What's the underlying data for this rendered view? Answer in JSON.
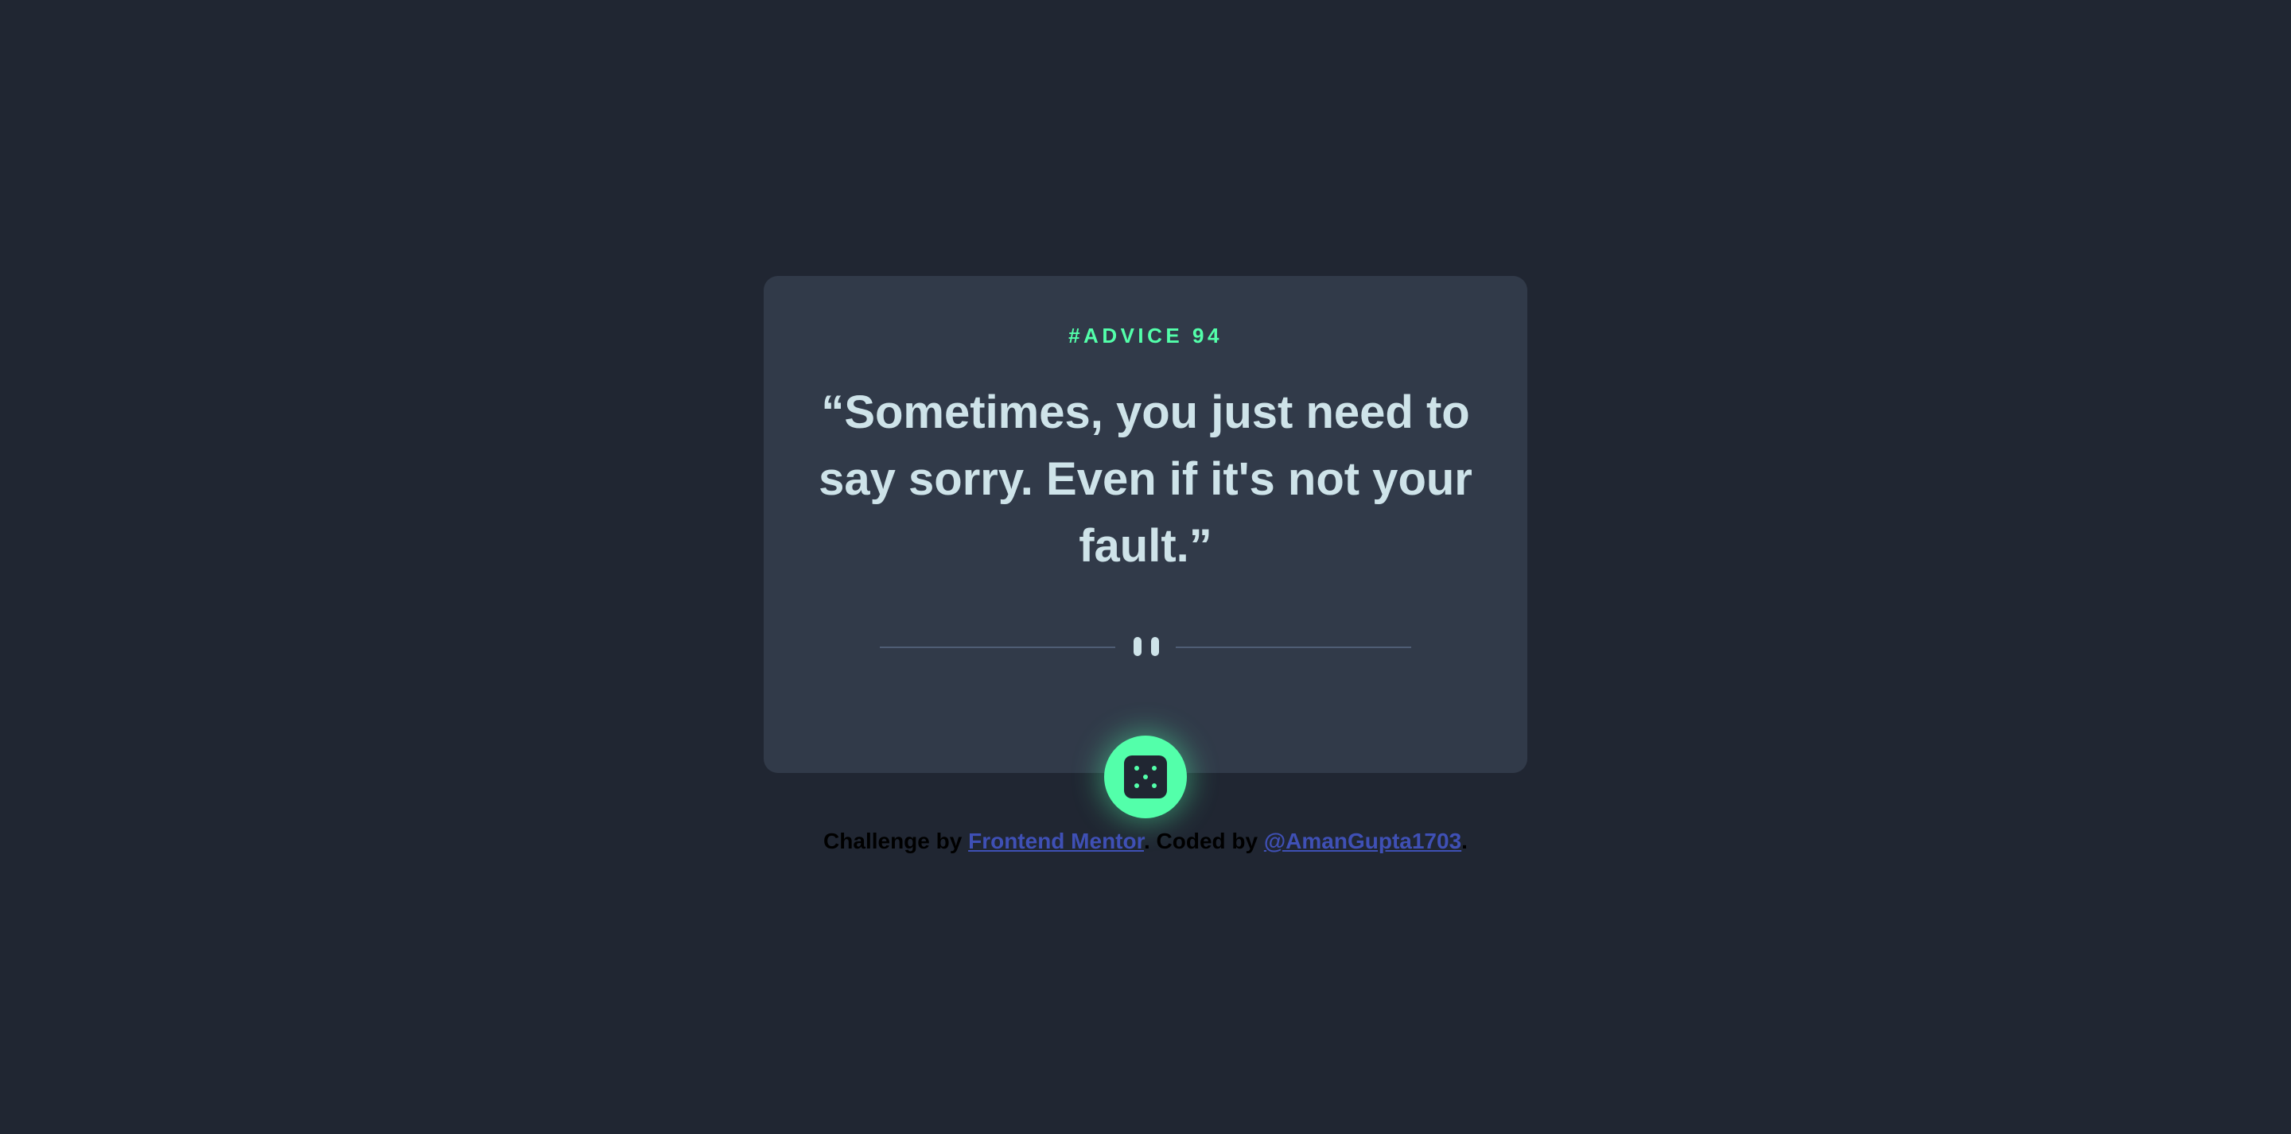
{
  "card": {
    "advice_label": "#ADVICE 94",
    "quote": "“Sometimes, you just need to say sorry. Even if it's not your fault.”"
  },
  "dice_button": {
    "icon": "dice-icon"
  },
  "footer": {
    "prefix": "Challenge by ",
    "link1": "Frontend Mentor",
    "middle": ". Coded by ",
    "link2": "@AmanGupta1703",
    "suffix": "."
  },
  "colors": {
    "background": "#202632",
    "card": "#313a49",
    "accent": "#53ffaa",
    "quote_text": "#cee3e9",
    "divider": "#4f5d74",
    "link": "#3f50b5"
  }
}
